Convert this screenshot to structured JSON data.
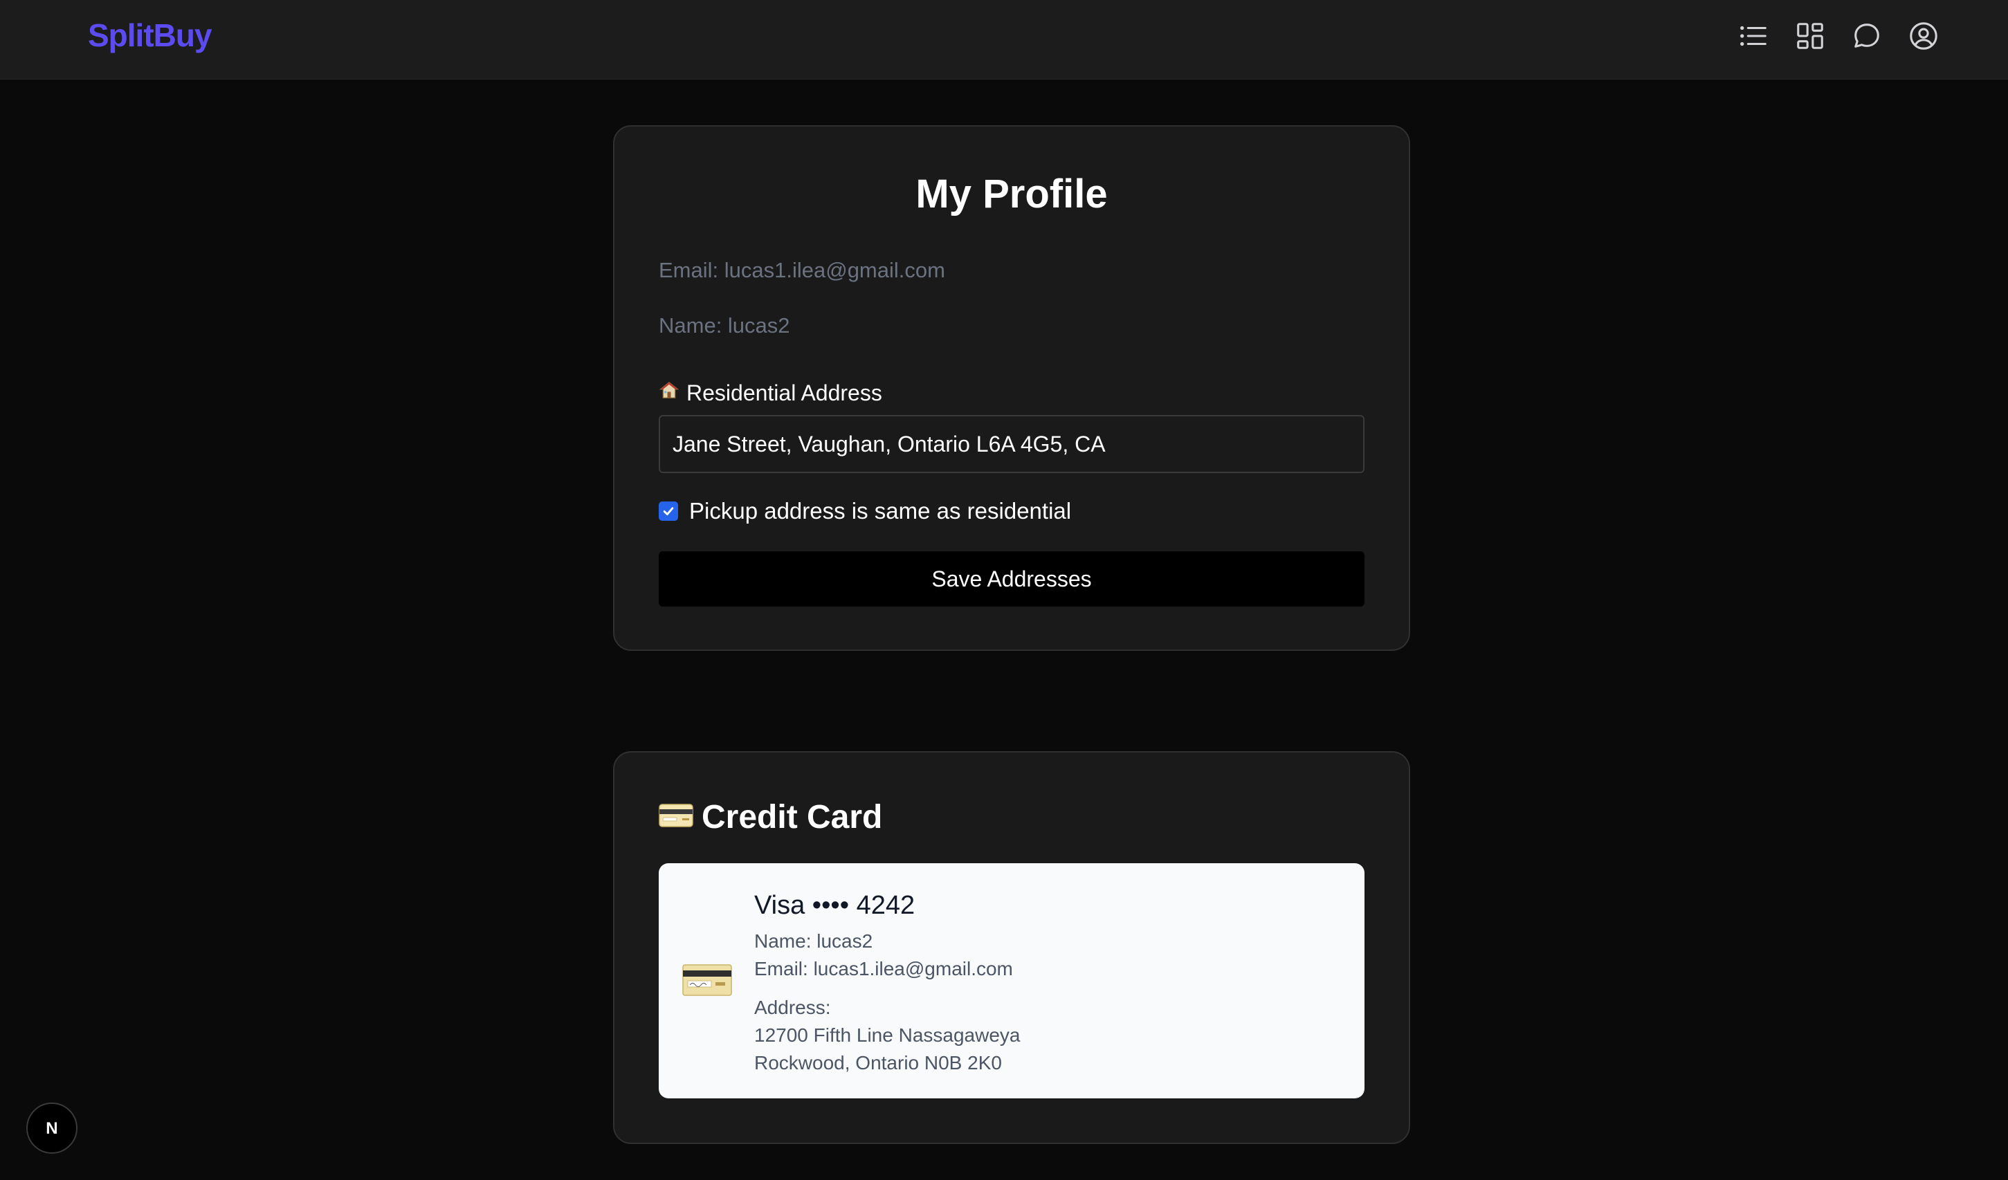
{
  "header": {
    "logo": "SplitBuy",
    "icons": [
      "list-icon",
      "grid-icon",
      "chat-icon",
      "user-icon"
    ],
    "brand_color": "#5b4bf0"
  },
  "profile": {
    "title": "My Profile",
    "email_line": "Email: lucas1.ilea@gmail.com",
    "name_line": "Name: lucas2",
    "residential_label": "Residential Address",
    "residential_value": "Jane Street, Vaughan, Ontario L6A 4G5, CA",
    "pickup_same_label": "Pickup address is same as residential",
    "pickup_same_checked": true,
    "save_button": "Save Addresses"
  },
  "credit_card": {
    "title": "Credit Card",
    "brand_line": "Visa •••• 4242",
    "name_line": "Name: lucas2",
    "email_line": "Email: lucas1.ilea@gmail.com",
    "address_label": "Address:",
    "address_line1": "12700 Fifth Line Nassagaweya",
    "address_line2": "Rockwood, Ontario N0B 2K0"
  },
  "dev_badge": {
    "letter": "N"
  },
  "colors": {
    "accent": "#2563eb",
    "background": "#0a0a0a",
    "card": "#1a1a1a"
  }
}
